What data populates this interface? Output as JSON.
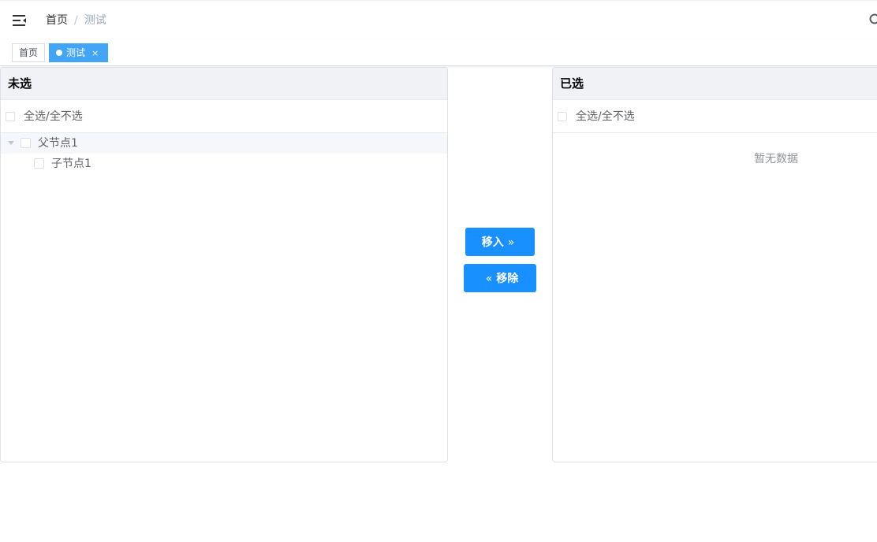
{
  "navbar": {
    "breadcrumb": {
      "home": "首页",
      "separator": "/",
      "current": "测试"
    },
    "hamburger_icon": "hamburger-icon",
    "search_icon": "search-icon"
  },
  "tags": [
    {
      "label": "首页",
      "active": false
    },
    {
      "label": "测试",
      "active": true,
      "close": "×"
    }
  ],
  "transfer": {
    "left": {
      "title": "未选",
      "check_all_label": "全选/全不选",
      "tree": [
        {
          "label": "父节点1",
          "expanded": true,
          "children": [
            {
              "label": "子节点1"
            }
          ]
        }
      ]
    },
    "right": {
      "title": "已选",
      "check_all_label": "全选/全不选",
      "empty_text": "暂无数据"
    },
    "buttons": {
      "move_in_label": "移入",
      "move_in_arrow": "»",
      "move_out_label": "移除",
      "move_out_arrow": "«"
    }
  },
  "colors": {
    "primary": "#1890ff",
    "tag_active": "#42a5f5",
    "panel_header_bg": "#f0f2f5"
  }
}
